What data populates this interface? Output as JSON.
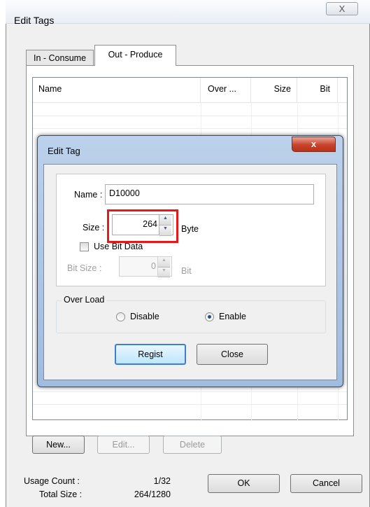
{
  "outer": {
    "title": "Edit Tags",
    "close_glyph": "X",
    "tabs": [
      {
        "label": "In - Consume"
      },
      {
        "label": "Out - Produce"
      }
    ],
    "list": {
      "columns": [
        "Name",
        "Over ...",
        "Size",
        "Bit"
      ],
      "rows": []
    },
    "buttons": {
      "new": "New...",
      "edit": "Edit...",
      "delete": "Delete",
      "ok": "OK",
      "cancel": "Cancel"
    },
    "usage": {
      "count_label": "Usage Count :",
      "count_value": "1/32",
      "size_label": "Total Size :",
      "size_value": "264/1280"
    }
  },
  "dialog": {
    "title": "Edit Tag",
    "close_glyph": "x",
    "name_label": "Name :",
    "name_value": "D10000",
    "size_label": "Size :",
    "size_value": "264",
    "size_unit": "Byte",
    "use_bit_label": "Use Bit Data",
    "use_bit_checked": false,
    "bit_size_label": "Bit Size :",
    "bit_size_value": "0",
    "bit_unit": "Bit",
    "overload_label": "Over Load",
    "disable_label": "Disable",
    "enable_label": "Enable",
    "selected_overload": "Enable",
    "regist_button": "Regist",
    "close_button": "Close"
  },
  "highlight_color": "#e41a1a",
  "accent_color": "#3c7fd1"
}
